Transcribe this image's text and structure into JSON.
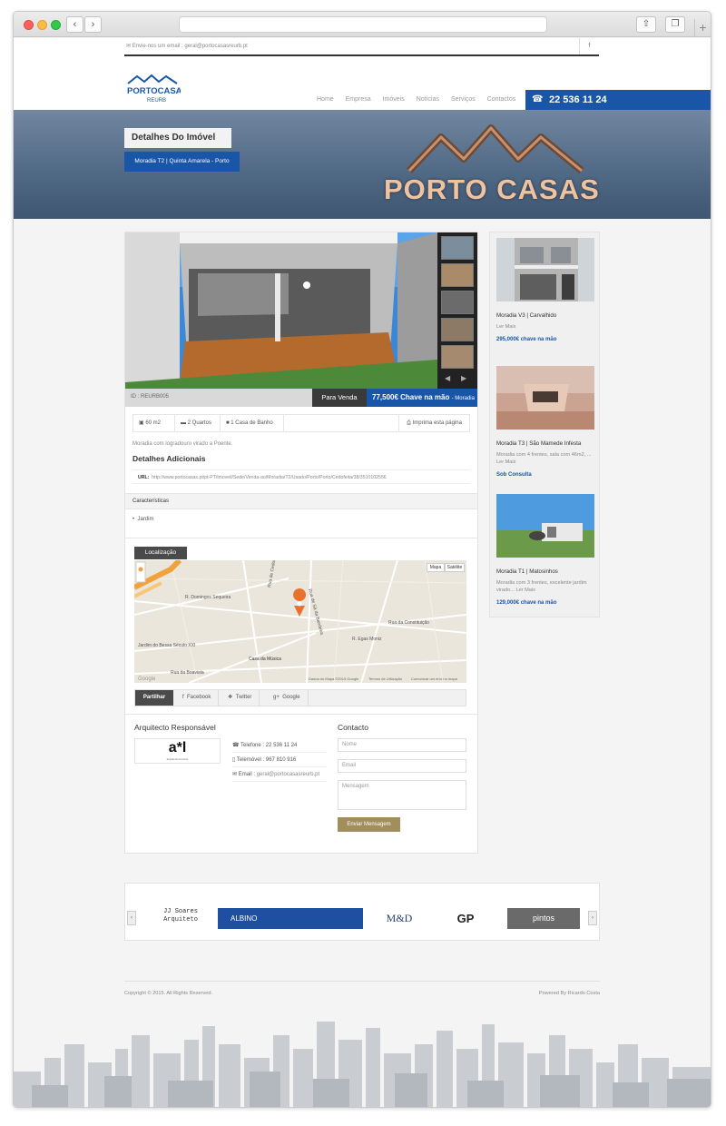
{
  "topbar": {
    "email_text": "Envie-nos um email : geral@portocasasreurb.pt",
    "facebook_icon": "f"
  },
  "logo": {
    "line1": "PORTOCASAS",
    "line2": "REURB"
  },
  "nav": {
    "items": [
      "Home",
      "Empresa",
      "Imóveis",
      "Notícias",
      "Serviços",
      "Contactos"
    ],
    "phone": "22 536 11 24"
  },
  "banner": {
    "title": "Detalhes Do Imóvel",
    "subtitle": "Moradia T2 | Quinta Amarela - Porto",
    "brand": "PORTO CASAS"
  },
  "property": {
    "id": "ID : REURB005",
    "status": "Para Venda",
    "price": "77,500€ Chave na mão",
    "type": "- Moradia",
    "features": [
      "60 m2",
      "2 Quartos",
      "1 Casa de Banho"
    ],
    "print": "Imprima esta página",
    "description": "Moradia com logradouro virado a Poente.",
    "details_heading": "Detalhes Adicionais",
    "url_label": "URL:",
    "url_value": "http://www.portocasas.pt/pt-PT/imoveil/Sede/Venda-ao/Moradia/T2/Usado/Porto/Porto/Cedofeita/38/3510102556",
    "characteristics_heading": "Características",
    "characteristics": [
      "Jardim"
    ]
  },
  "location": {
    "tab": "Localização",
    "map_btn": "Mapa",
    "sat_btn": "Satélite",
    "streets": [
      "Rua de Sá da Bandeira",
      "R. Domingos Sequeira",
      "Rua de Cedofeita",
      "R. Egas Moniz",
      "Rua da Constituição",
      "Rua da Boavista",
      "Casa da Música",
      "Jardim do Bessa Século XXI"
    ],
    "footer": [
      "Dados do Mapa ©2015 Google",
      "Termos de Utilização",
      "Comunicar um erro no mapa"
    ]
  },
  "share": {
    "label": "Partilhar",
    "facebook": "Facebook",
    "twitter": "Twitter",
    "google": "Google"
  },
  "architect": {
    "heading": "Arquitecto Responsável",
    "logo_text": "a*l",
    "logo_sub": "arquitectura locus",
    "phone": "Telefone : 22 536 11 24",
    "mobile": "Telemóvel : 967 810 916",
    "email_label": "Email :",
    "email": "geral@portocasasreurb.pt"
  },
  "contact": {
    "heading": "Contacto",
    "name_placeholder": "Nome",
    "email_placeholder": "Email",
    "message_placeholder": "Mensagem",
    "send": "Enviar Mensagem"
  },
  "sidebar": [
    {
      "title": "Moradia V3 | Carvalhido",
      "text": "Ler Mais",
      "price": "295,000€ chave na mão"
    },
    {
      "title": "Moradia T3 | São Mamede Infesta",
      "text": "Moradia com 4 frentes, sala com 46m2, ... Ler Mais",
      "price": "Sob Consulta"
    },
    {
      "title": "Moradia T1 | Matosinhos",
      "text": "Moradia com 3 frentes, excelente jardim virado... Ler Mais",
      "price": "129,000€ chave na mão"
    }
  ],
  "partners": [
    "JJ Soares Arquiteto",
    "ALBINO",
    "M&D",
    "GP",
    "pintos"
  ],
  "footer": {
    "copyright": "Copyright © 2015. All Rights Reserved.",
    "powered": "Powered By Ricardo Costa"
  },
  "colors": {
    "brand_blue": "#1a56a8",
    "dark": "#4a4a4a",
    "send_button": "#a28d5d"
  }
}
